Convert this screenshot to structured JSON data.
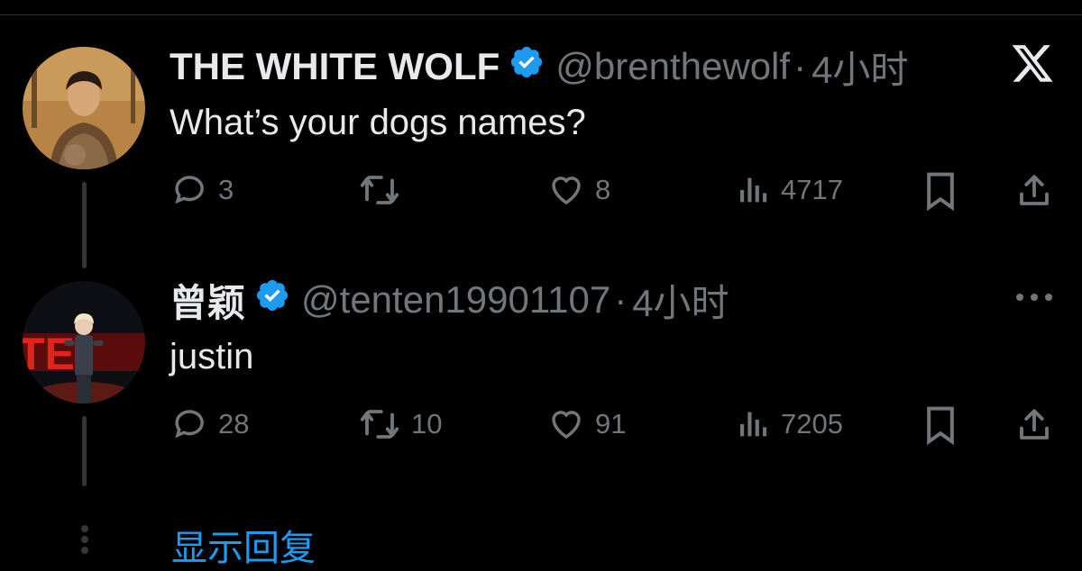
{
  "tweets": [
    {
      "name": "THE WHITE WOLF",
      "handle": "@brenthewolf",
      "separator": "·",
      "time": "4小时",
      "text": "What’s your dogs names?",
      "stats": {
        "replies": "3",
        "retweets": "",
        "likes": "8",
        "views": "4717"
      }
    },
    {
      "name": "曾颖",
      "handle": "@tenten19901107",
      "separator": "·",
      "time": "4小时",
      "text": "justin",
      "stats": {
        "replies": "28",
        "retweets": "10",
        "likes": "91",
        "views": "7205"
      }
    }
  ],
  "footer": {
    "show_replies": "显示回复"
  },
  "colors": {
    "background": "#000000",
    "muted": "#71767b",
    "accent": "#1d9bf0",
    "verified": "#1d9bf0"
  },
  "icons": [
    "x-logo-icon",
    "verified-badge-icon",
    "reply-icon",
    "retweet-icon",
    "like-icon",
    "views-icon",
    "bookmark-icon",
    "share-icon",
    "more-icon"
  ]
}
